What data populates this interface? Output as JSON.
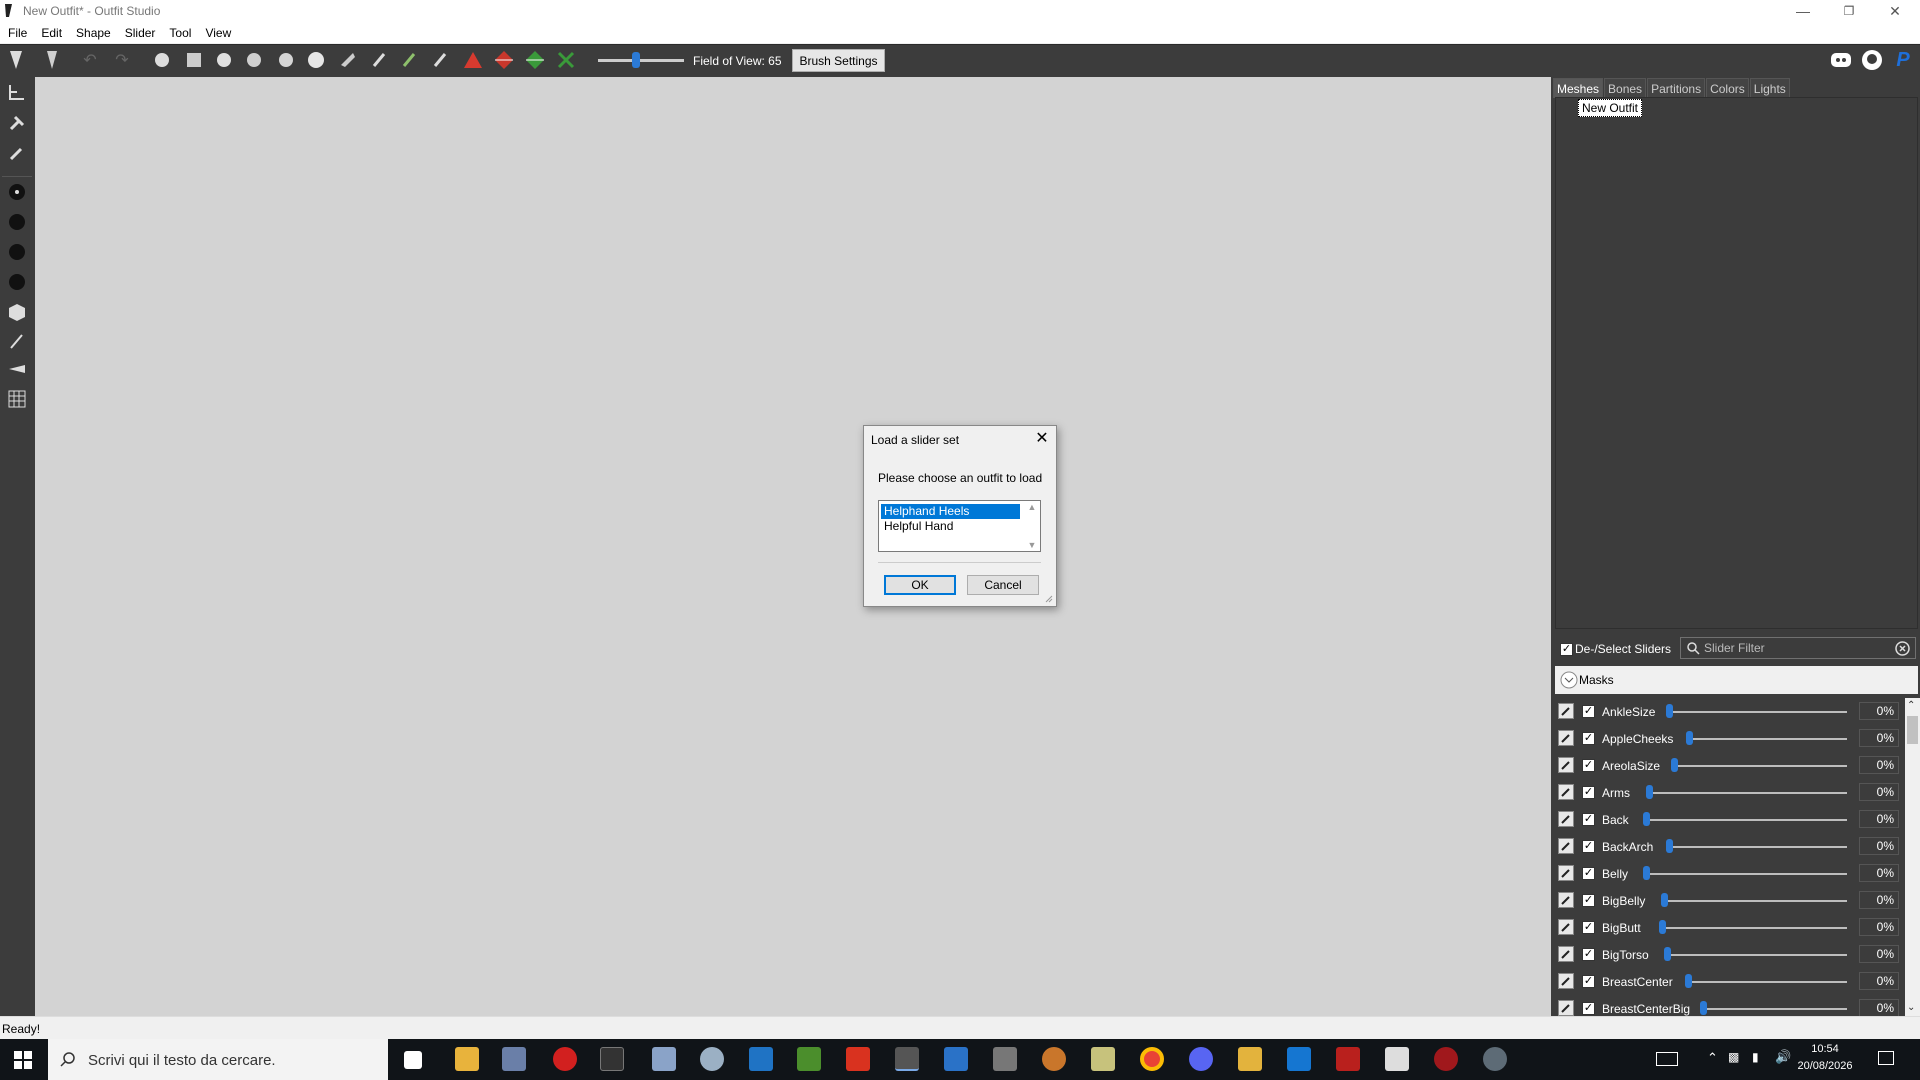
{
  "window": {
    "title": "New Outfit* - Outfit Studio"
  },
  "menu": [
    "File",
    "Edit",
    "Shape",
    "Slider",
    "Tool",
    "View"
  ],
  "toolbar": {
    "fov_label": "Field of View: 65",
    "brush_settings": "Brush Settings"
  },
  "tabs": [
    "Meshes",
    "Bones",
    "Partitions",
    "Colors",
    "Lights"
  ],
  "tree": {
    "root": "New Outfit"
  },
  "sliders_panel": {
    "select_label": "De-/Select Sliders",
    "filter_placeholder": "Slider Filter",
    "masks_label": "Masks",
    "items": [
      {
        "name": "AnkleSize",
        "value": "0%"
      },
      {
        "name": "AppleCheeks",
        "value": "0%"
      },
      {
        "name": "AreolaSize",
        "value": "0%"
      },
      {
        "name": "Arms",
        "value": "0%"
      },
      {
        "name": "Back",
        "value": "0%"
      },
      {
        "name": "BackArch",
        "value": "0%"
      },
      {
        "name": "Belly",
        "value": "0%"
      },
      {
        "name": "BigBelly",
        "value": "0%"
      },
      {
        "name": "BigButt",
        "value": "0%"
      },
      {
        "name": "BigTorso",
        "value": "0%"
      },
      {
        "name": "BreastCenter",
        "value": "0%"
      },
      {
        "name": "BreastCenterBig",
        "value": "0%"
      }
    ]
  },
  "status": {
    "text": "Ready!"
  },
  "dialog": {
    "title": "Load a slider set",
    "prompt": "Please choose an outfit to load",
    "options": [
      "Helphand Heels",
      "Helpful Hand"
    ],
    "selected": "Helphand Heels",
    "ok": "OK",
    "cancel": "Cancel"
  },
  "taskbar": {
    "search_placeholder": "Scrivi qui il testo da cercare.",
    "time": "10:54",
    "date": "20/08/2026"
  },
  "colors": {
    "accent": "#0078d7",
    "panel": "#3c3c3c",
    "viewport": "#d3d3d3",
    "slider_thumb": "#2b7ad6"
  }
}
